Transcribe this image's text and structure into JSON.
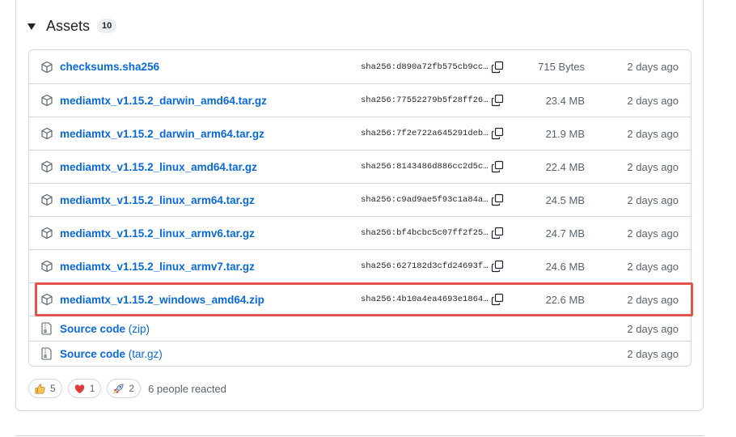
{
  "assets": {
    "title": "Assets",
    "count": "10",
    "files": [
      {
        "name": "checksums.sha256",
        "sha": "sha256:d890a72fb575cb9cc…",
        "size": "715 Bytes",
        "date": "2 days ago"
      },
      {
        "name": "mediamtx_v1.15.2_darwin_amd64.tar.gz",
        "sha": "sha256:77552279b5f28ff26…",
        "size": "23.4 MB",
        "date": "2 days ago"
      },
      {
        "name": "mediamtx_v1.15.2_darwin_arm64.tar.gz",
        "sha": "sha256:7f2e722a645291deb…",
        "size": "21.9 MB",
        "date": "2 days ago"
      },
      {
        "name": "mediamtx_v1.15.2_linux_amd64.tar.gz",
        "sha": "sha256:8143486d886cc2d5c…",
        "size": "22.4 MB",
        "date": "2 days ago"
      },
      {
        "name": "mediamtx_v1.15.2_linux_arm64.tar.gz",
        "sha": "sha256:c9ad9ae5f93c1a84a…",
        "size": "24.5 MB",
        "date": "2 days ago"
      },
      {
        "name": "mediamtx_v1.15.2_linux_armv6.tar.gz",
        "sha": "sha256:bf4bcbc5c07ff2f25…",
        "size": "24.7 MB",
        "date": "2 days ago"
      },
      {
        "name": "mediamtx_v1.15.2_linux_armv7.tar.gz",
        "sha": "sha256:627182d3cfd24693f…",
        "size": "24.6 MB",
        "date": "2 days ago"
      },
      {
        "name": "mediamtx_v1.15.2_windows_amd64.zip",
        "sha": "sha256:4b10a4ea4693e1864…",
        "size": "22.6 MB",
        "date": "2 days ago"
      }
    ],
    "source": [
      {
        "label": "Source code",
        "ext": "(zip)",
        "date": "2 days ago"
      },
      {
        "label": "Source code",
        "ext": "(tar.gz)",
        "date": "2 days ago"
      }
    ]
  },
  "reactions": {
    "items": [
      {
        "icon": "thumbs-up-icon",
        "count": "5"
      },
      {
        "icon": "heart-icon",
        "count": "1"
      },
      {
        "icon": "rocket-icon",
        "count": "2"
      }
    ],
    "summary": "6 people reacted"
  },
  "colors": {
    "link": "#0969da",
    "border": "#d0d7de",
    "muted": "#59636e",
    "highlight": "#e5534b"
  }
}
